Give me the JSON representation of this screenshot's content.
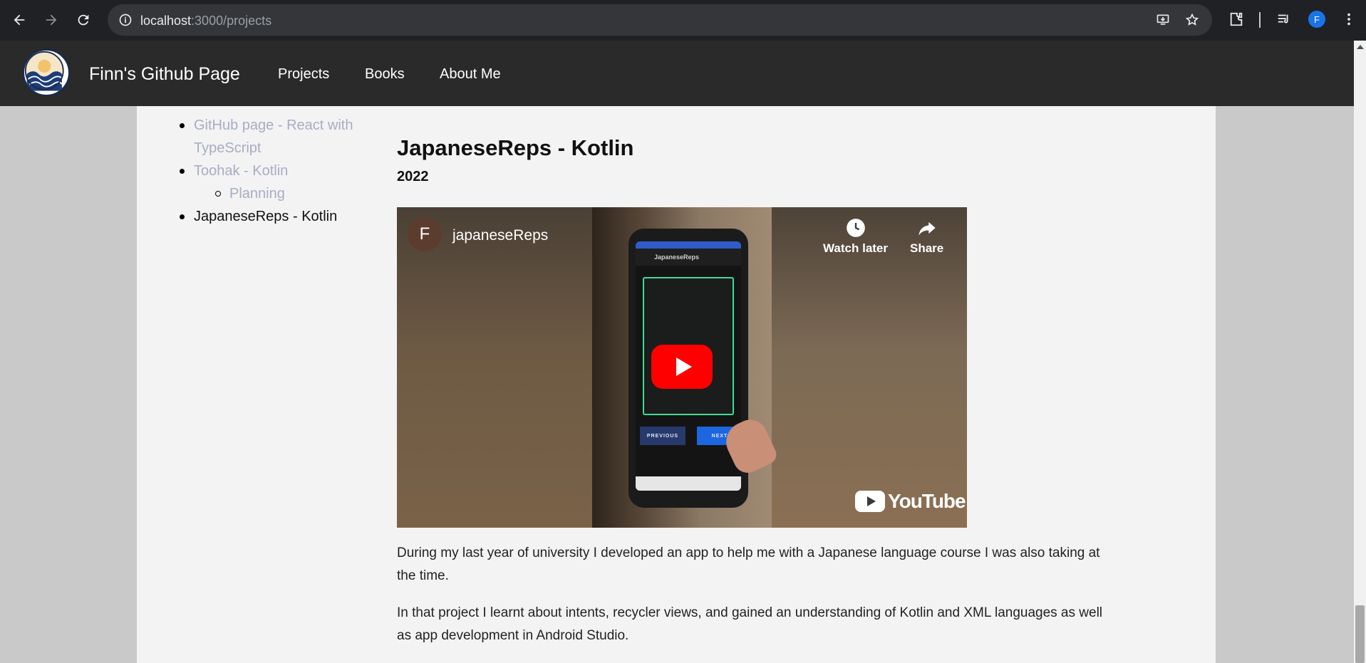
{
  "browser": {
    "url_host": "localhost",
    "url_path": ":3000/projects",
    "profile_initial": "F"
  },
  "site": {
    "brand": "Finn's Github Page",
    "nav": [
      "Projects",
      "Books",
      "About Me"
    ]
  },
  "toc": {
    "items": [
      {
        "label": "GitHub page - React with TypeScript"
      },
      {
        "label": "Toohak - Kotlin"
      },
      {
        "label": "Planning"
      },
      {
        "label": "JapaneseReps - Kotlin"
      }
    ]
  },
  "project": {
    "title": "JapaneseReps - Kotlin",
    "year": "2022",
    "video": {
      "channel_initial": "F",
      "channel_name": "japaneseReps",
      "watch_later": "Watch later",
      "share": "Share",
      "phone_app_title": "JapaneseReps",
      "prev_label": "PREVIOUS",
      "next_label": "NEXT",
      "brand": "YouTube"
    },
    "paragraphs": [
      "During my last year of university I developed an app to help me with a Japanese language course I was also taking at the time.",
      "In that project I learnt about intents, recycler views, and gained an understanding of Kotlin and XML languages as well as app development in Android Studio."
    ]
  },
  "colors": {
    "navbar": "#2a2a2a",
    "link": "#a6aec4",
    "play": "#ff0000"
  }
}
